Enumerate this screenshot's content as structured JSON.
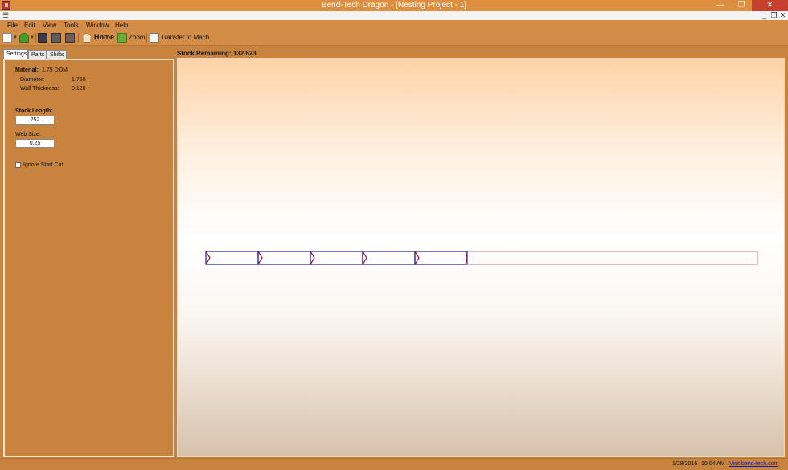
{
  "window": {
    "title": "Bend-Tech Dragon - [Nesting Project - 1]",
    "controls": {
      "minimize": "—",
      "restore": "❐",
      "close": "✕"
    },
    "mdi_controls": {
      "minimize": "_",
      "restore": "❐",
      "close": "✕"
    }
  },
  "menu": [
    "File",
    "Edit",
    "View",
    "Tools",
    "Window",
    "Help"
  ],
  "toolbar": {
    "home_label": "Home",
    "zoom_label": "Zoom",
    "transfer_label": "Transfer to Mach"
  },
  "tabs": [
    "Settings",
    "Parts",
    "Shifts"
  ],
  "settings": {
    "material_label": "Material:",
    "material_value": "1.75 DOM",
    "diameter_label": "Diameter:",
    "diameter_value": "1.750",
    "wall_label": "Wall Thickness:",
    "wall_value": "0.120",
    "stock_length_label": "Stock Length:",
    "stock_length_value": "252",
    "web_size_label": "Web Size:",
    "web_size_value": "0.25",
    "ignore_start_cut_label": "Ignore Start Cut",
    "ignore_start_cut_checked": false
  },
  "stock": {
    "remaining_label": "Stock Remaining:",
    "remaining_value": "132.623"
  },
  "nest": {
    "stock_length": 252,
    "used_length": 119.377,
    "part_count": 5,
    "part_color": "#1d1d9c",
    "remnant_color": "#e06a8c"
  },
  "status": {
    "date": "1/28/2016",
    "time": "10:04 AM",
    "link": "Visit bend-tech.com"
  }
}
